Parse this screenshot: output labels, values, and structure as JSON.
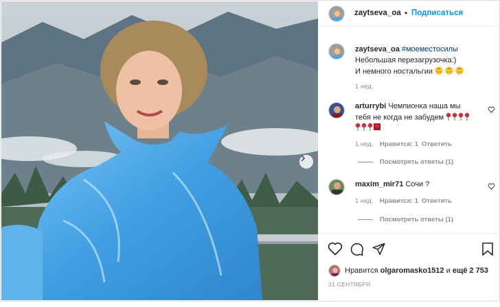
{
  "header": {
    "username": "zaytseva_oa",
    "separator": "•",
    "follow_label": "Подписаться"
  },
  "caption": {
    "username": "zaytseva_oa",
    "hashtag": "#моеместосилы",
    "line1": "Небольшая перезагрузочка:)",
    "line2": "И немного ностальгии",
    "emoji_icon": "upside-down-face-emoji",
    "time": "1 нед."
  },
  "comments": [
    {
      "username": "arturrybi",
      "text_line1": "Чемпионка наша мы",
      "text_line2": "тебя не когда не забудем",
      "emoji_icon": "rose-emoji",
      "time": "1 нед.",
      "likes": "Нравится: 1",
      "reply": "Ответить",
      "view_replies": "Посмотреть ответы (1)"
    },
    {
      "username": "maxim_mir71",
      "text": "Сочи ?",
      "time": "1 нед.",
      "likes": "Нравится: 1",
      "reply": "Ответить",
      "view_replies": "Посмотреть ответы (1)"
    }
  ],
  "likes": {
    "prefix": "Нравится",
    "user": "olgaromasko1512",
    "and": "и",
    "more": "ещё 2 753"
  },
  "date": "21 СЕНТЯБРЯ",
  "colors": {
    "accent": "#0095f6",
    "text": "#262626",
    "muted": "#8e8e8e",
    "raincoat": "#4aa6e6"
  },
  "icons": [
    "heart-icon",
    "comment-icon",
    "share-icon",
    "bookmark-icon",
    "chevron-right-icon"
  ]
}
